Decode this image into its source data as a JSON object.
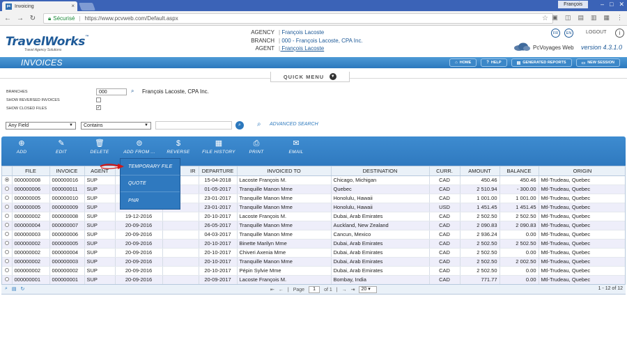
{
  "browser": {
    "tab_title": "Invoicing",
    "favicon_text": "pc",
    "secure_label": "Sécurisé",
    "url": "https://www.pcvweb.com/Default.aspx",
    "profile": "François"
  },
  "header": {
    "logo": "TravelWorks",
    "logo_tm": "™",
    "logo_sub": "Travel Agency Solutions",
    "labels": {
      "agency": "AGENCY",
      "branch": "BRANCH",
      "agent": "AGENT"
    },
    "agency": "François Lacoste",
    "branch": "000 - François Lacoste, CPA Inc.",
    "agent": "François Lacoste",
    "lang_fr": "FR",
    "lang_en": "EN",
    "logout": "LOGOUT",
    "product": "PcVoyages Web",
    "version": "version 4.3.1.0"
  },
  "titlebar": {
    "title": "INVOICES",
    "nav": [
      {
        "label": "HOME",
        "icon": "home-icon"
      },
      {
        "label": "HELP",
        "icon": "help-icon"
      },
      {
        "label": "GENERATED REPORTS",
        "icon": "reports-icon"
      },
      {
        "label": "NEW SESSION",
        "icon": "monitor-icon"
      }
    ]
  },
  "quick_menu": "QUICK MENU",
  "filters": {
    "branches_label": "BRANCHES",
    "branch_value": "000",
    "branch_name": "François Lacoste, CPA Inc.",
    "show_reversed_label": "SHOW REVERSED INVOICES",
    "show_reversed": false,
    "show_closed_label": "SHOW CLOSED FILES",
    "show_closed": true,
    "field_select": "Any Field",
    "operator_select": "Contains",
    "advanced_search": "ADVANCED SEARCH"
  },
  "toolbar": {
    "add": "ADD",
    "edit": "EDIT",
    "delete": "DELETE",
    "add_from": "ADD FROM ...",
    "reverse": "REVERSE",
    "file_history": "FILE HISTORY",
    "print": "PRINT",
    "email": "EMAIL"
  },
  "add_from_menu": [
    "TEMPORARY FILE",
    "QUOTE",
    "PNR"
  ],
  "table": {
    "columns": [
      "FILE",
      "INVOICE",
      "AGENT",
      "",
      "IR",
      "DEPARTURE",
      "INVOICED TO",
      "DESTINATION",
      "CURR.",
      "AMOUNT",
      "BALANCE",
      "ORIGIN"
    ],
    "rows": [
      [
        "000000008",
        "000000016",
        "SUP",
        "",
        "",
        "15-04-2018",
        "Lacoste François M.",
        "Chicago, Michigan",
        "CAD",
        "450.46",
        "450.46",
        "Mtl-Trudeau, Quebec"
      ],
      [
        "000000006",
        "000000011",
        "SUP",
        "",
        "",
        "01-05-2017",
        "Tranquille Manon Mme",
        "Quebec",
        "CAD",
        "2 510.94",
        "- 300.00",
        "Mtl-Trudeau, Quebec"
      ],
      [
        "000000005",
        "000000010",
        "SUP",
        "",
        "",
        "23-01-2017",
        "Tranquille Manon Mme",
        "Honolulu, Hawaii",
        "CAD",
        "1 001.00",
        "1 001.00",
        "Mtl-Trudeau, Quebec"
      ],
      [
        "000000005",
        "000000009",
        "SUP",
        "",
        "",
        "23-01-2017",
        "Tranquille Manon Mme",
        "Honolulu, Hawaii",
        "USD",
        "1 451.45",
        "1 451.45",
        "Mtl-Trudeau, Quebec"
      ],
      [
        "000000002",
        "000000008",
        "SUP",
        "19-12-2016",
        "",
        "20-10-2017",
        "Lacoste François M.",
        "Dubai, Arab Emirates",
        "CAD",
        "2 502.50",
        "2 502.50",
        "Mtl-Trudeau, Quebec"
      ],
      [
        "000000004",
        "000000007",
        "SUP",
        "20-09-2016",
        "",
        "26-05-2017",
        "Tranquille Manon Mme",
        "Auckland, New Zealand",
        "CAD",
        "2 090.83",
        "2 090.83",
        "Mtl-Trudeau, Quebec"
      ],
      [
        "000000003",
        "000000006",
        "SUP",
        "20-09-2016",
        "",
        "04-03-2017",
        "Tranquille Manon Mme",
        "Cancun, Mexico",
        "CAD",
        "2 936.24",
        "0.00",
        "Mtl-Trudeau, Quebec"
      ],
      [
        "000000002",
        "000000005",
        "SUP",
        "20-09-2016",
        "",
        "20-10-2017",
        "Binette Marilyn Mme",
        "Dubai, Arab Emirates",
        "CAD",
        "2 502.50",
        "2 502.50",
        "Mtl-Trudeau, Quebec"
      ],
      [
        "000000002",
        "000000004",
        "SUP",
        "20-09-2016",
        "",
        "20-10-2017",
        "Chiveri Axenia Mme",
        "Dubai, Arab Emirates",
        "CAD",
        "2 502.50",
        "0.00",
        "Mtl-Trudeau, Quebec"
      ],
      [
        "000000002",
        "000000003",
        "SUP",
        "20-09-2016",
        "",
        "20-10-2017",
        "Tranquille Manon Mme",
        "Dubai, Arab Emirates",
        "CAD",
        "2 502.50",
        "2 002.50",
        "Mtl-Trudeau, Quebec"
      ],
      [
        "000000002",
        "000000002",
        "SUP",
        "20-09-2016",
        "",
        "20-10-2017",
        "Pépin Sylvie Mme",
        "Dubai, Arab Emirates",
        "CAD",
        "2 502.50",
        "0.00",
        "Mtl-Trudeau, Quebec"
      ],
      [
        "000000001",
        "000000001",
        "SUP",
        "20-09-2016",
        "",
        "20-09-2017",
        "Lacoste François M.",
        "Bombay, India",
        "CAD",
        "771.77",
        "0.00",
        "Mtl-Trudeau, Quebec"
      ]
    ]
  },
  "pager": {
    "page_label": "Page",
    "page": "1",
    "of_label": "of 1",
    "page_size": "20",
    "summary": "1 - 12 of 12"
  }
}
